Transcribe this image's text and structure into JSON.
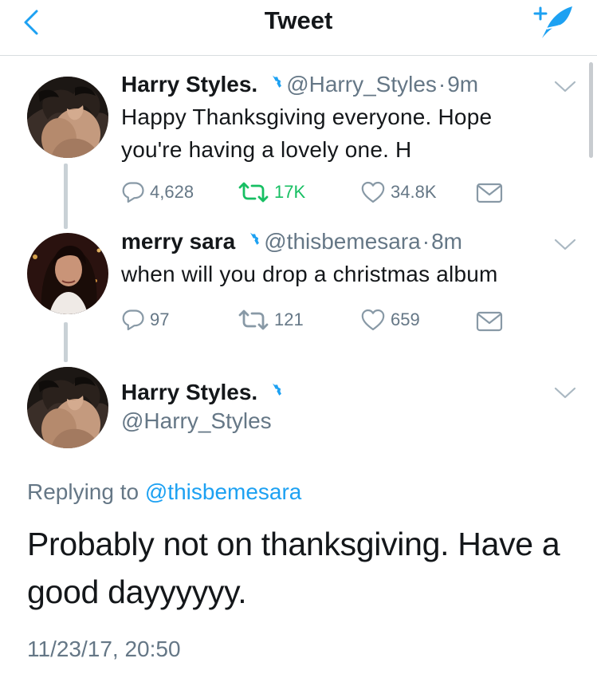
{
  "nav": {
    "title": "Tweet"
  },
  "tweets": [
    {
      "name": "Harry Styles.",
      "handle": "@Harry_Styles",
      "separator": "·",
      "time": "9m",
      "text_line1": "Happy Thanksgiving everyone. Hope",
      "text_line2": "you're having a lovely one. H",
      "replies": "4,628",
      "retweets": "17K",
      "likes": "34.8K"
    },
    {
      "name": "merry sara",
      "handle": "@thisbemesara",
      "separator": "·",
      "time": "8m",
      "text_line1": "when will you drop a christmas album",
      "replies": "97",
      "retweets": "121",
      "likes": "659"
    }
  ],
  "focused": {
    "name": "Harry Styles.",
    "handle": "@Harry_Styles",
    "replying_prefix": "Replying to",
    "replying_to": "@thisbemesara",
    "text": "Probably not on thanksgiving. Have a good dayyyyyy.",
    "timestamp": "11/23/17, 20:50"
  },
  "colors": {
    "accent": "#1da1f2",
    "retweet": "#17bf63",
    "secondary": "#657786",
    "icon": "#8899a6",
    "thread_line": "#c9d1d6"
  },
  "icons": {
    "back": "chevron-left-icon",
    "compose": "compose-tweet-icon",
    "verified": "verified-badge-icon",
    "reply": "reply-icon",
    "retweet": "retweet-icon",
    "like": "heart-icon",
    "dm": "envelope-icon",
    "more": "chevron-down-icon"
  }
}
